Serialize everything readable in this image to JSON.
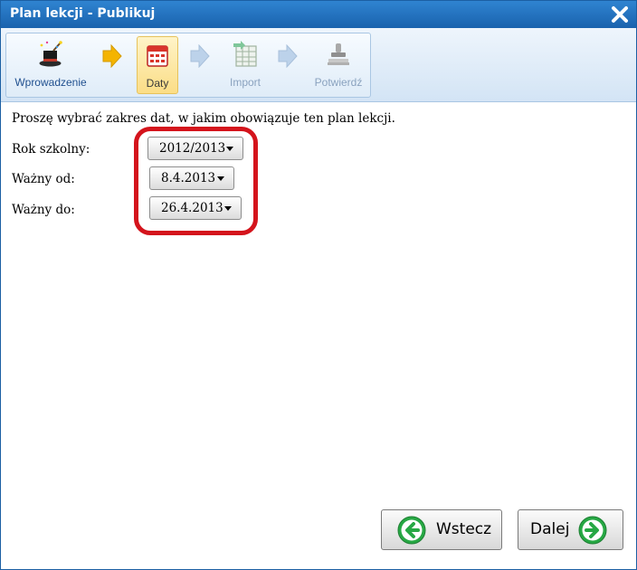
{
  "window": {
    "title": "Plan lekcji - Publikuj"
  },
  "wizard": {
    "steps": [
      {
        "label": "Wprowadzenie",
        "icon": "magic-hat-icon",
        "state": "done"
      },
      {
        "label": "Daty",
        "icon": "calendar-icon",
        "state": "active"
      },
      {
        "label": "Import",
        "icon": "spreadsheet-icon",
        "state": "disabled"
      },
      {
        "label": "Potwierdź",
        "icon": "stamp-icon",
        "state": "disabled"
      }
    ]
  },
  "form": {
    "instruction": "Proszę wybrać zakres dat, w jakim obowiązuje ten plan lekcji.",
    "school_year": {
      "label": "Rok szkolny:",
      "value": "2012/2013"
    },
    "valid_from": {
      "label": "Ważny od:",
      "value": "8.4.2013"
    },
    "valid_to": {
      "label": "Ważny do:",
      "value": "26.4.2013"
    }
  },
  "buttons": {
    "back": "Wstecz",
    "next": "Dalej"
  },
  "colors": {
    "titlebar": "#1a62ad",
    "highlight": "#d4141c",
    "nav_green": "#27a844",
    "active_step": "#fbdd86"
  }
}
